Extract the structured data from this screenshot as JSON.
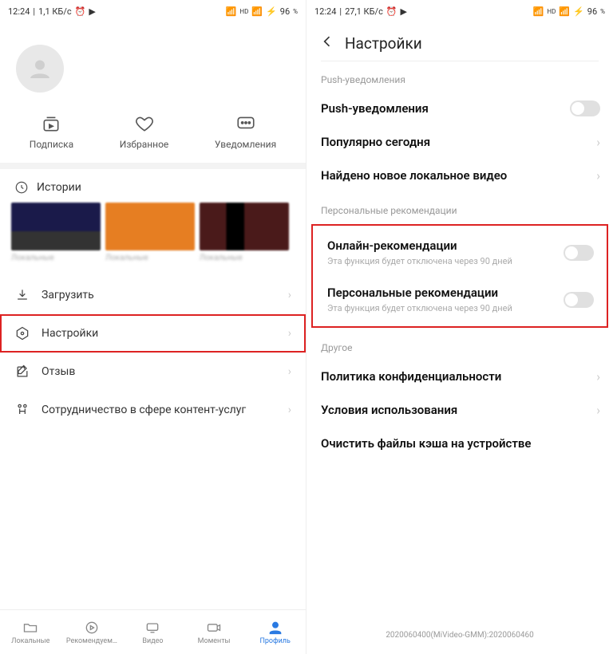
{
  "left": {
    "statusbar": {
      "time": "12:24",
      "speed": "1,1 КБ/с",
      "battery": "96"
    },
    "tabs": {
      "sub": "Подписка",
      "fav": "Избранное",
      "noti": "Уведомления"
    },
    "histories": "Истории",
    "thumbs": [
      {
        "cap": "Локальные"
      },
      {
        "cap": "Локальные"
      },
      {
        "cap": "Локальные"
      }
    ],
    "menu": {
      "download": "Загрузить",
      "settings": "Настройки",
      "feedback": "Отзыв",
      "partner": "Сотрудничество в сфере контент-услуг"
    },
    "bottom": {
      "local": "Локальные",
      "rec": "Рекомендуем…",
      "video": "Видео",
      "moments": "Моменты",
      "profile": "Профиль"
    }
  },
  "right": {
    "statusbar": {
      "time": "12:24",
      "speed": "27,1 КБ/с",
      "battery": "96"
    },
    "title": "Настройки",
    "sect_push": "Push-уведомления",
    "rows": {
      "push": "Push-уведомления",
      "popular": "Популярно сегодня",
      "newlocal": "Найдено новое локальное видео"
    },
    "sect_pers": "Персональные рекомендации",
    "rec_rows": {
      "online": {
        "t": "Онлайн-рекомендации",
        "s": "Эта функция будет отключена через 90 дней"
      },
      "pers": {
        "t": "Персональные рекомендации",
        "s": "Эта функция будет отключена через 90 дней"
      }
    },
    "sect_other": "Другое",
    "other_rows": {
      "privacy": "Политика конфиденциальности",
      "terms": "Условия использования",
      "cache": "Очистить файлы кэша на устройстве"
    },
    "version": "2020060400(MiVideo-GMM):2020060460"
  }
}
